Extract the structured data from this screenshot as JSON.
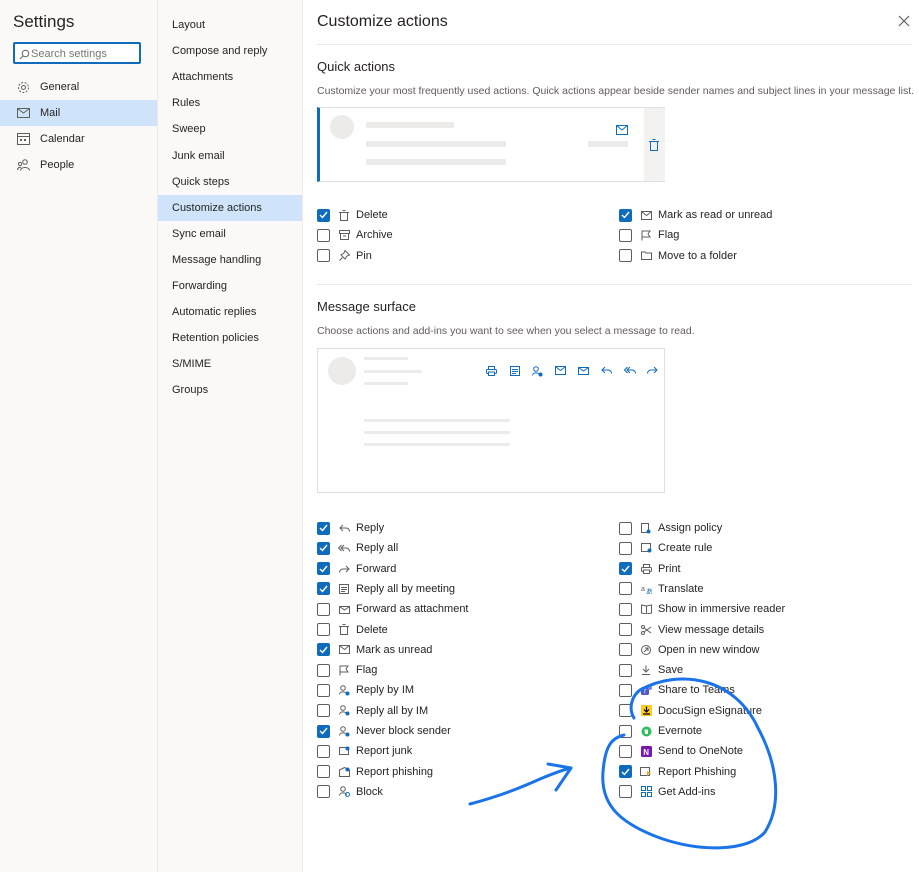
{
  "settings_title": "Settings",
  "search": {
    "placeholder": "Search settings"
  },
  "nav1": [
    {
      "label": "General",
      "icon": "gear-icon"
    },
    {
      "label": "Mail",
      "icon": "mail-icon",
      "selected": true
    },
    {
      "label": "Calendar",
      "icon": "calendar-icon"
    },
    {
      "label": "People",
      "icon": "people-icon"
    }
  ],
  "nav2": [
    {
      "label": "Layout"
    },
    {
      "label": "Compose and reply"
    },
    {
      "label": "Attachments"
    },
    {
      "label": "Rules"
    },
    {
      "label": "Sweep"
    },
    {
      "label": "Junk email"
    },
    {
      "label": "Quick steps"
    },
    {
      "label": "Customize actions",
      "selected": true
    },
    {
      "label": "Sync email"
    },
    {
      "label": "Message handling"
    },
    {
      "label": "Forwarding"
    },
    {
      "label": "Automatic replies"
    },
    {
      "label": "Retention policies"
    },
    {
      "label": "S/MIME"
    },
    {
      "label": "Groups"
    }
  ],
  "main": {
    "title": "Customize actions",
    "quick": {
      "title": "Quick actions",
      "desc": "Customize your most frequently used actions. Quick actions appear beside sender names and subject lines in your message list.",
      "left": [
        {
          "label": "Delete",
          "checked": true,
          "icon": "trash-icon"
        },
        {
          "label": "Archive",
          "checked": false,
          "icon": "archive-icon"
        },
        {
          "label": "Pin",
          "checked": false,
          "icon": "pin-icon"
        }
      ],
      "right": [
        {
          "label": "Mark as read or unread",
          "checked": true,
          "icon": "envelope-icon"
        },
        {
          "label": "Flag",
          "checked": false,
          "icon": "flag-icon"
        },
        {
          "label": "Move to a folder",
          "checked": false,
          "icon": "folder-icon"
        }
      ]
    },
    "surface": {
      "title": "Message surface",
      "desc": "Choose actions and add-ins you want to see when you select a message to read.",
      "left": [
        {
          "label": "Reply",
          "checked": true,
          "icon": "reply-icon"
        },
        {
          "label": "Reply all",
          "checked": true,
          "icon": "reply-all-icon"
        },
        {
          "label": "Forward",
          "checked": true,
          "icon": "forward-icon"
        },
        {
          "label": "Reply all by meeting",
          "checked": true,
          "icon": "calendar-reply-icon"
        },
        {
          "label": "Forward as attachment",
          "checked": false,
          "icon": "forward-attachment-icon"
        },
        {
          "label": "Delete",
          "checked": false,
          "icon": "trash-icon"
        },
        {
          "label": "Mark as unread",
          "checked": true,
          "icon": "envelope-icon"
        },
        {
          "label": "Flag",
          "checked": false,
          "icon": "flag-icon"
        },
        {
          "label": "Reply by IM",
          "checked": false,
          "icon": "im-icon"
        },
        {
          "label": "Reply all by IM",
          "checked": false,
          "icon": "im-icon"
        },
        {
          "label": "Never block sender",
          "checked": true,
          "icon": "person-check-icon"
        },
        {
          "label": "Report junk",
          "checked": false,
          "icon": "junk-icon"
        },
        {
          "label": "Report phishing",
          "checked": false,
          "icon": "phishing-icon"
        },
        {
          "label": "Block",
          "checked": false,
          "icon": "block-person-icon"
        }
      ],
      "right": [
        {
          "label": "Assign policy",
          "checked": false,
          "icon": "policy-icon"
        },
        {
          "label": "Create rule",
          "checked": false,
          "icon": "rule-icon"
        },
        {
          "label": "Print",
          "checked": true,
          "icon": "print-icon"
        },
        {
          "label": "Translate",
          "checked": false,
          "icon": "translate-icon"
        },
        {
          "label": "Show in immersive reader",
          "checked": false,
          "icon": "immersive-reader-icon"
        },
        {
          "label": "View message details",
          "checked": false,
          "icon": "details-icon"
        },
        {
          "label": "Open in new window",
          "checked": false,
          "icon": "new-window-icon"
        },
        {
          "label": "Save",
          "checked": false,
          "icon": "save-icon"
        },
        {
          "label": "Share to Teams",
          "checked": false,
          "icon": "teams-icon"
        },
        {
          "label": "DocuSign eSignature",
          "checked": false,
          "icon": "docusign-icon"
        },
        {
          "label": "Evernote",
          "checked": false,
          "icon": "evernote-icon"
        },
        {
          "label": "Send to OneNote",
          "checked": false,
          "icon": "onenote-icon"
        },
        {
          "label": "Report Phishing",
          "checked": true,
          "icon": "report-phishing-addin-icon"
        },
        {
          "label": "Get Add-ins",
          "checked": false,
          "icon": "grid-addins-icon"
        }
      ]
    }
  },
  "colors": {
    "accent": "#0f6cbd",
    "selected_bg": "#cfe4fa",
    "annotation": "#1a73e8"
  }
}
